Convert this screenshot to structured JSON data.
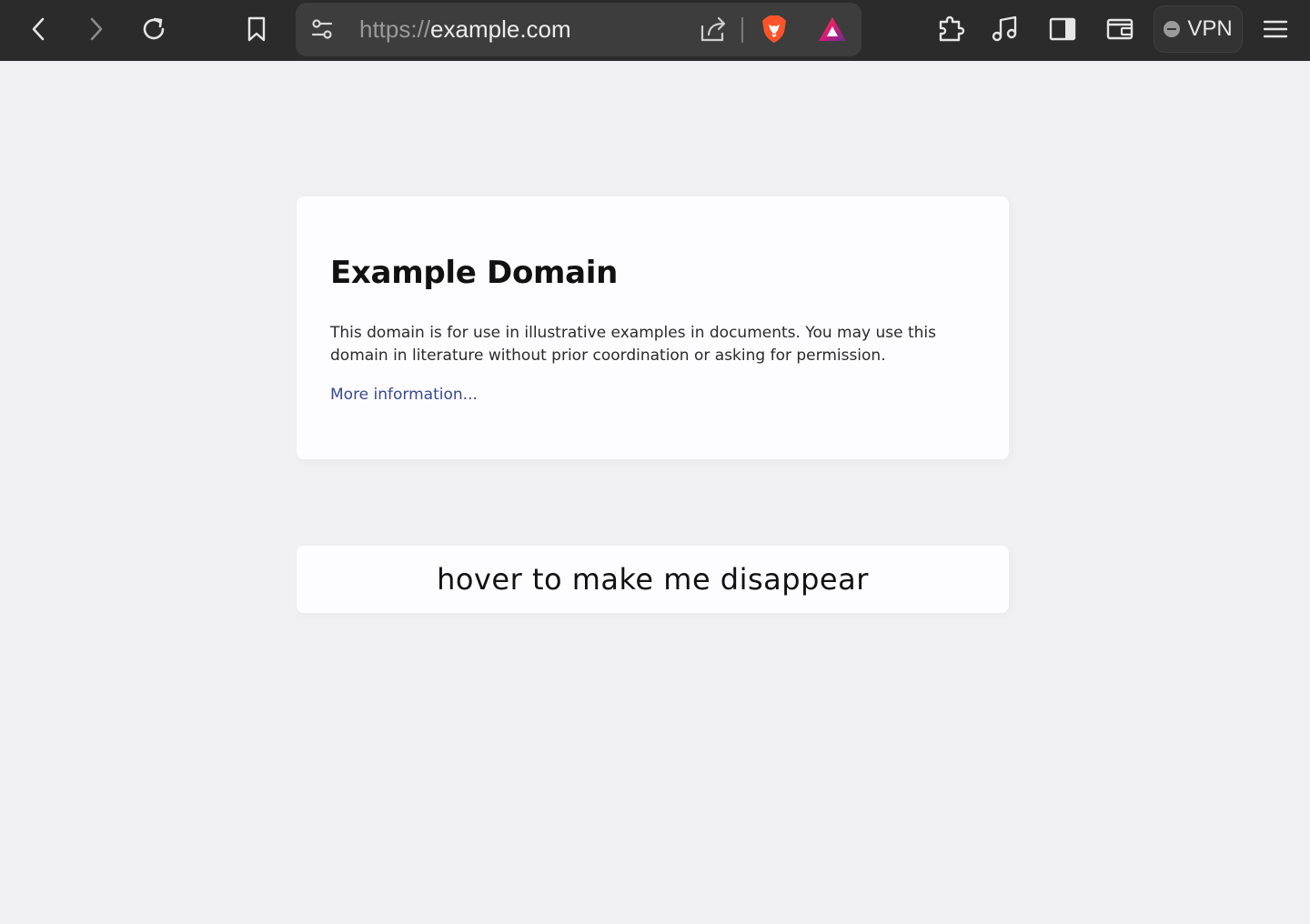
{
  "browser": {
    "url_scheme": "https://",
    "url_host": "example.com",
    "vpn_label": "VPN",
    "icons": {
      "back": "chevron-left-icon",
      "forward": "chevron-right-icon",
      "reload": "reload-icon",
      "bookmark": "bookmark-icon",
      "site_settings": "sliders-icon",
      "share": "share-icon",
      "brave_shields": "brave-lion-icon",
      "rewards": "brave-rewards-triangle-icon",
      "extensions": "puzzle-piece-icon",
      "media": "music-note-icon",
      "sidebar": "sidebar-icon",
      "wallet": "wallet-icon",
      "menu": "hamburger-menu-icon"
    },
    "colors": {
      "toolbar_bg": "#2b2b2b",
      "urlbar_bg": "#3d3d3d",
      "brave_orange": "#fb542b"
    }
  },
  "page": {
    "title": "Example Domain",
    "description": "This domain is for use in illustrative examples in documents. You may use this domain in literature without prior coordination or asking for permission.",
    "link_text": "More information...",
    "hover_box_text": "hover to make me disappear",
    "colors": {
      "background": "#f0f0f2",
      "card_bg": "#fdfdff",
      "link": "#38488f"
    }
  }
}
